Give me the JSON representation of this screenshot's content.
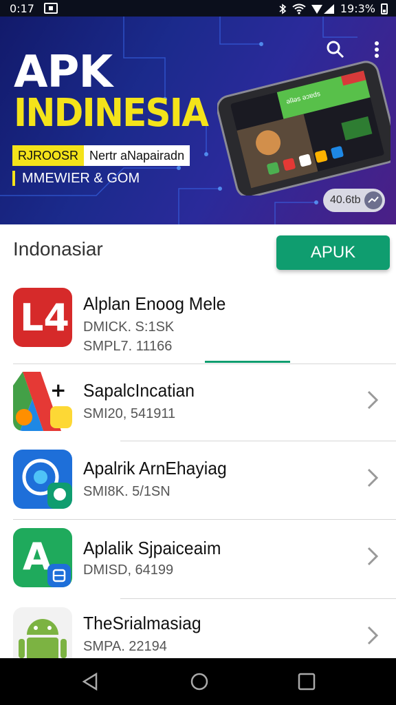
{
  "status_bar": {
    "time": "0:17",
    "battery_text": "19:3%"
  },
  "banner": {
    "logo_line1": "APK",
    "logo_line2": "INDINESIA",
    "tag_yellow": "RJROOSR",
    "tag_white": "Nertr aNapairadn",
    "subtitle": "MMEWIER & GOM",
    "pill_text": "40.6tb",
    "phone_screen_text": "ǝlʇǝs ǝɔɐds"
  },
  "section": {
    "title": "Indonasiar",
    "button_label": "APUK"
  },
  "apps": [
    {
      "name": "Alplan Enoog Mele",
      "meta1": "DMICK. S:1SK",
      "meta2": "SMPL7. 11166",
      "icon_text": "L4"
    },
    {
      "name": "SapalcIncatian",
      "meta1": "SMI20, 541911",
      "meta2": ""
    },
    {
      "name": "Apalrik ArnEhayiag",
      "meta1": "SMI8K. 5/1SN",
      "meta2": ""
    },
    {
      "name": "Aplalik Sjpaiceaim",
      "meta1": "DMISD, 64199",
      "meta2": "",
      "icon_text": "A"
    },
    {
      "name": "TheSrialmasiag",
      "meta1": "SMPA. 22194",
      "meta2": ""
    }
  ],
  "colors": {
    "accent_green": "#0f9d6f",
    "logo_yellow": "#f4e31a",
    "banner_blue": "#1b2a8c"
  },
  "icons": [
    "search-icon",
    "more-vert-icon",
    "chevron-right-icon",
    "back-icon",
    "home-icon",
    "recents-icon",
    "wifi-icon",
    "signal-icon",
    "bluetooth-icon",
    "battery-icon"
  ]
}
